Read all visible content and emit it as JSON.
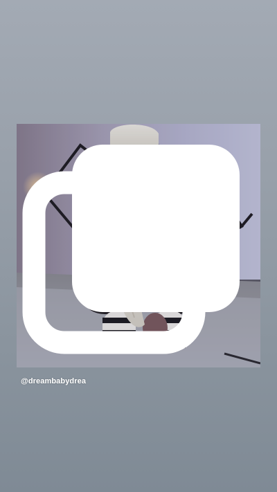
{
  "story": {
    "mention_text": "@dreambabydrea",
    "icons": {
      "multi_post": "multiple-images-icon"
    },
    "colors": {
      "background_top": "#a3aab4",
      "background_bottom": "#7f8a95",
      "mention_text": "#ffffff"
    }
  }
}
